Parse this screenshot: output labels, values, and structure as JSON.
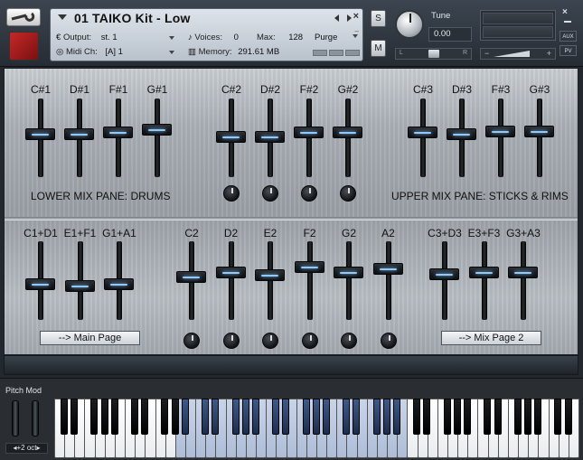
{
  "header": {
    "instrument_title": "01 TAIKO Kit - Low",
    "output_label": "Output:",
    "output_value": "st. 1",
    "voices_label": "Voices:",
    "voices_value": "0",
    "max_label": "Max:",
    "max_value": "128",
    "purge_label": "Purge",
    "midi_label": "Midi Ch:",
    "midi_value": "[A] 1",
    "memory_label": "Memory:",
    "memory_value": "291.61 MB",
    "solo_label": "S",
    "mute_label": "M",
    "tune_label": "Tune",
    "tune_value": "0.00",
    "pan_left": "L",
    "pan_right": "R",
    "vol_minus": "−",
    "vol_plus": "+",
    "aux_label": "AUX",
    "pv_label": "PV"
  },
  "upper_groups": [
    {
      "channels": [
        {
          "label": "C#1",
          "level": 0.45
        },
        {
          "label": "D#1",
          "level": 0.45
        },
        {
          "label": "F#1",
          "level": 0.42
        },
        {
          "label": "G#1",
          "level": 0.38
        }
      ]
    },
    {
      "channels": [
        {
          "label": "C#2",
          "level": 0.48,
          "knob": true
        },
        {
          "label": "D#2",
          "level": 0.48,
          "knob": true
        },
        {
          "label": "F#2",
          "level": 0.42,
          "knob": true
        },
        {
          "label": "G#2",
          "level": 0.42,
          "knob": true
        }
      ]
    },
    {
      "channels": [
        {
          "label": "C#3",
          "level": 0.42
        },
        {
          "label": "D#3",
          "level": 0.45
        },
        {
          "label": "F#3",
          "level": 0.4
        },
        {
          "label": "G#3",
          "level": 0.4
        }
      ]
    }
  ],
  "lower_mix_label": "LOWER MIX PANE: DRUMS",
  "upper_mix_label": "UPPER MIX PANE: STICKS & RIMS",
  "lower_groups": [
    {
      "channels": [
        {
          "label": "C1+D1",
          "level": 0.55
        },
        {
          "label": "E1+F1",
          "level": 0.58
        },
        {
          "label": "G1+A1",
          "level": 0.55
        }
      ]
    },
    {
      "channels": [
        {
          "label": "C2",
          "level": 0.45,
          "knob": true
        },
        {
          "label": "D2",
          "level": 0.38,
          "knob": true
        },
        {
          "label": "E2",
          "level": 0.42,
          "knob": true
        },
        {
          "label": "F2",
          "level": 0.3,
          "knob": true
        },
        {
          "label": "G2",
          "level": 0.38,
          "knob": true
        },
        {
          "label": "A2",
          "level": 0.32,
          "knob": true
        }
      ]
    },
    {
      "channels": [
        {
          "label": "C3+D3",
          "level": 0.4
        },
        {
          "label": "E3+F3",
          "level": 0.38
        },
        {
          "label": "G3+A3",
          "level": 0.38
        }
      ]
    }
  ],
  "main_page_button": "-->  Main Page",
  "mix_page2_button": "-->  Mix Page 2",
  "keyboard": {
    "pitch_mod_label": "Pitch Mod",
    "octave_label": "+2 oct"
  }
}
